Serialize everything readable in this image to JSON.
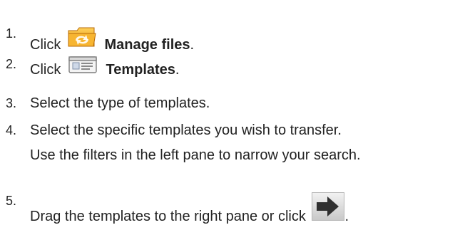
{
  "steps": [
    {
      "number": "1.",
      "before": "Click",
      "icon": "manage-files-folder-icon",
      "bold": "Manage files",
      "after": "."
    },
    {
      "number": "2.",
      "before": "Click",
      "icon": "templates-icon",
      "bold": "Templates",
      "after": "."
    },
    {
      "number": "3.",
      "text": "Select the type of templates."
    },
    {
      "number": "4.",
      "text": "Select the specific templates you wish to transfer.",
      "text2": "Use the filters in the left pane to narrow your search."
    },
    {
      "number": "5.",
      "text": "Drag the templates to the right pane or click",
      "icon": "right-arrow-icon",
      "after": "."
    }
  ],
  "colors": {
    "text": "#222222",
    "folder_orange": "#f2a21a",
    "arrow_fill": "#2f2f2f",
    "button_bg": "#d9d9d9"
  }
}
